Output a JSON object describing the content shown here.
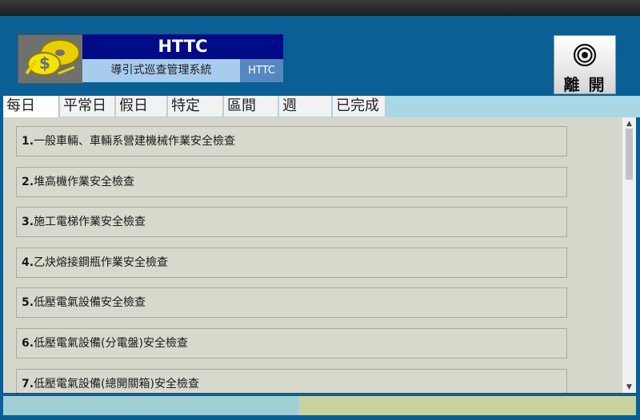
{
  "header": {
    "logo_icon": "cd-disc-logo-icon",
    "title": "HTTC",
    "subtitle": "導引式巡查管理系統",
    "code": "HTTC"
  },
  "exit_button": {
    "label": "離 開",
    "icon": "target-icon"
  },
  "tabs": [
    {
      "label": "每日",
      "active": true
    },
    {
      "label": "平常日",
      "active": false
    },
    {
      "label": "假日",
      "active": false
    },
    {
      "label": "特定",
      "active": false
    },
    {
      "label": "區間",
      "active": false
    },
    {
      "label": "週",
      "active": false
    },
    {
      "label": "已完成",
      "active": false
    }
  ],
  "items": [
    {
      "num": "1.",
      "label": "一般車輛、車輛系營建機械作業安全檢查"
    },
    {
      "num": "2.",
      "label": "堆高機作業安全檢查"
    },
    {
      "num": "3.",
      "label": "施工電梯作業安全檢查"
    },
    {
      "num": "4.",
      "label": "乙炔熔接鋼瓶作業安全檢查"
    },
    {
      "num": "5.",
      "label": "低壓電氣設備安全檢查"
    },
    {
      "num": "6.",
      "label": "低壓電氣設備(分電盤)安全檢查"
    },
    {
      "num": "7.",
      "label": "低壓電氣設備(總開關箱)安全檢查"
    }
  ],
  "scrollbar": {
    "up_arrow": "chevron-up-icon",
    "down_arrow": "chevron-down-icon"
  },
  "colors": {
    "background": "#0a5f94",
    "title_bar": "#000c85",
    "subtitle_bar": "#a8ccee",
    "tab_bar": "#a9d7e6",
    "content": "#d6d7cb",
    "footer_left": "#9fcfd5",
    "footer_right": "#c8d3a0"
  }
}
